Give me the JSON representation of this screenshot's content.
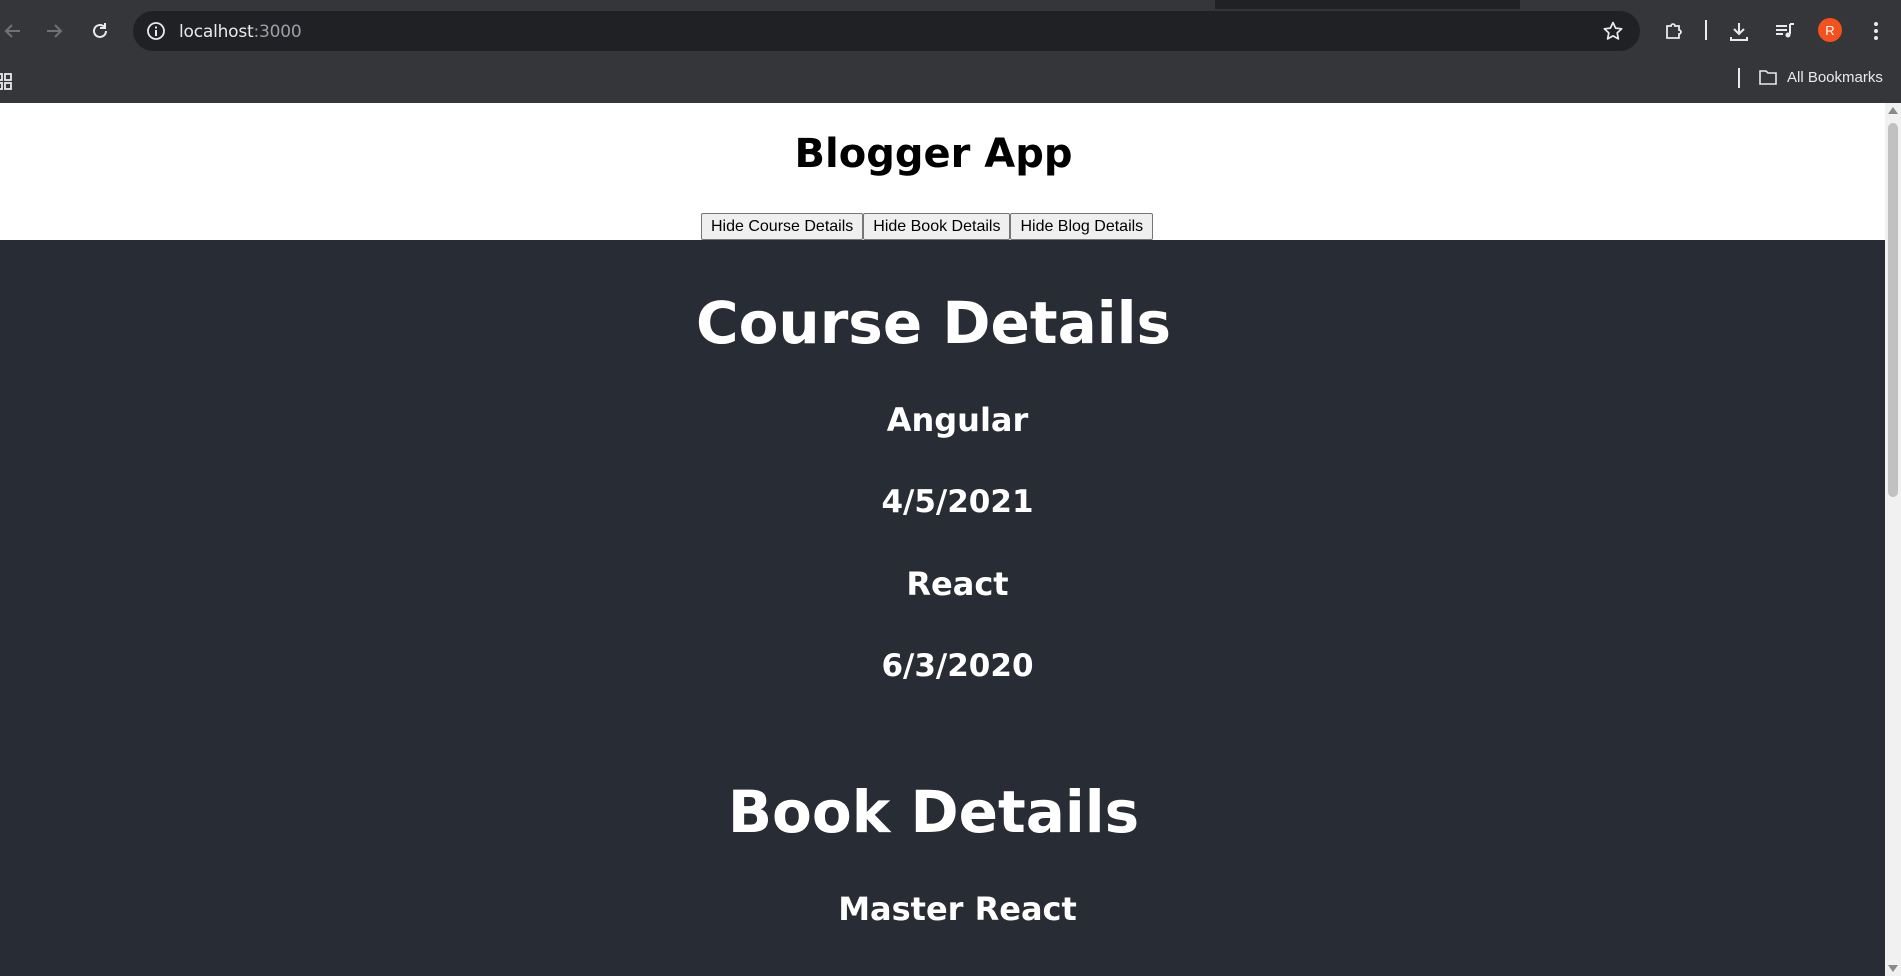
{
  "browser": {
    "url_host": "localhost",
    "url_port": ":3000",
    "avatar_initial": "R",
    "bookmarks_label": "All Bookmarks",
    "icons": [
      "back-icon",
      "forward-icon",
      "reload-icon",
      "info-icon",
      "star-icon",
      "extensions-icon",
      "download-icon",
      "media-controls-icon",
      "more-icon",
      "apps-icon",
      "folder-icon"
    ],
    "avatar_color": "#f4511e"
  },
  "page": {
    "title": "Blogger App",
    "buttons": {
      "hide_course": "Hide Course Details",
      "hide_book": "Hide Book Details",
      "hide_blog": "Hide Blog Details"
    },
    "background_color": "#282c34",
    "course_section": {
      "heading": "Course Details",
      "courses": [
        {
          "name": "Angular",
          "date": "4/5/2021"
        },
        {
          "name": "React",
          "date": "6/3/2020"
        }
      ]
    },
    "book_section": {
      "heading": "Book Details",
      "books": [
        {
          "name": "Master React"
        }
      ]
    }
  }
}
